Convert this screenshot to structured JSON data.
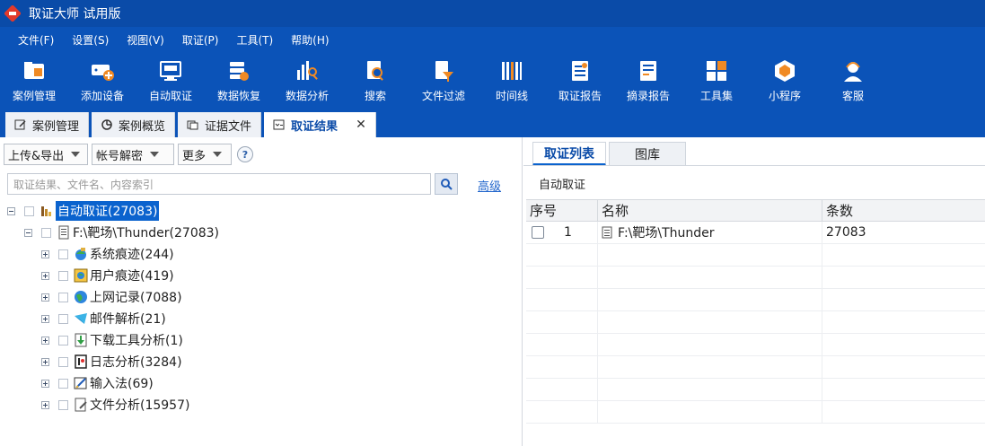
{
  "window": {
    "title": "取证大师 试用版"
  },
  "menu": [
    "文件(F)",
    "设置(S)",
    "视图(V)",
    "取证(P)",
    "工具(T)",
    "帮助(H)"
  ],
  "toolbar": [
    {
      "label": "案例管理",
      "icon": "case-folder-icon"
    },
    {
      "label": "添加设备",
      "icon": "add-device-icon"
    },
    {
      "label": "自动取证",
      "icon": "auto-forensics-icon"
    },
    {
      "label": "数据恢复",
      "icon": "data-recovery-icon"
    },
    {
      "label": "数据分析",
      "icon": "data-analysis-icon"
    },
    {
      "label": "搜索",
      "icon": "search-doc-icon"
    },
    {
      "label": "文件过滤",
      "icon": "file-filter-icon"
    },
    {
      "label": "时间线",
      "icon": "timeline-icon"
    },
    {
      "label": "取证报告",
      "icon": "forensic-report-icon"
    },
    {
      "label": "摘录报告",
      "icon": "excerpt-report-icon"
    },
    {
      "label": "工具集",
      "icon": "toolset-icon"
    },
    {
      "label": "小程序",
      "icon": "mini-program-icon"
    },
    {
      "label": "客服",
      "icon": "customer-service-icon"
    }
  ],
  "tabs": [
    {
      "label": "案例管理"
    },
    {
      "label": "案例概览"
    },
    {
      "label": "证据文件"
    },
    {
      "label": "取证结果",
      "close": "✕"
    }
  ],
  "left": {
    "upload_export": "上传&导出",
    "account_decrypt": "帐号解密",
    "more": "更多",
    "help": "?",
    "search_placeholder": "取证结果、文件名、内容索引",
    "advanced": "高级",
    "tree": {
      "root": "自动取证(27083)",
      "source": "F:\\靶场\\Thunder(27083)",
      "items": [
        "系统痕迹(244)",
        "用户痕迹(419)",
        "上网记录(7088)",
        "邮件解析(21)",
        "下载工具分析(1)",
        "日志分析(3284)",
        "输入法(69)",
        "文件分析(15957)"
      ]
    }
  },
  "right": {
    "tabs": [
      "取证列表",
      "图库"
    ],
    "sub_label": "自动取证",
    "columns": [
      "序号",
      "名称",
      "条数"
    ],
    "rows": [
      {
        "index": "1",
        "name": "F:\\靶场\\Thunder",
        "count": "27083"
      }
    ]
  },
  "colors": {
    "brand": "#0b53b8",
    "title_bar": "#0a4ba8",
    "selection": "#0b63ce"
  }
}
